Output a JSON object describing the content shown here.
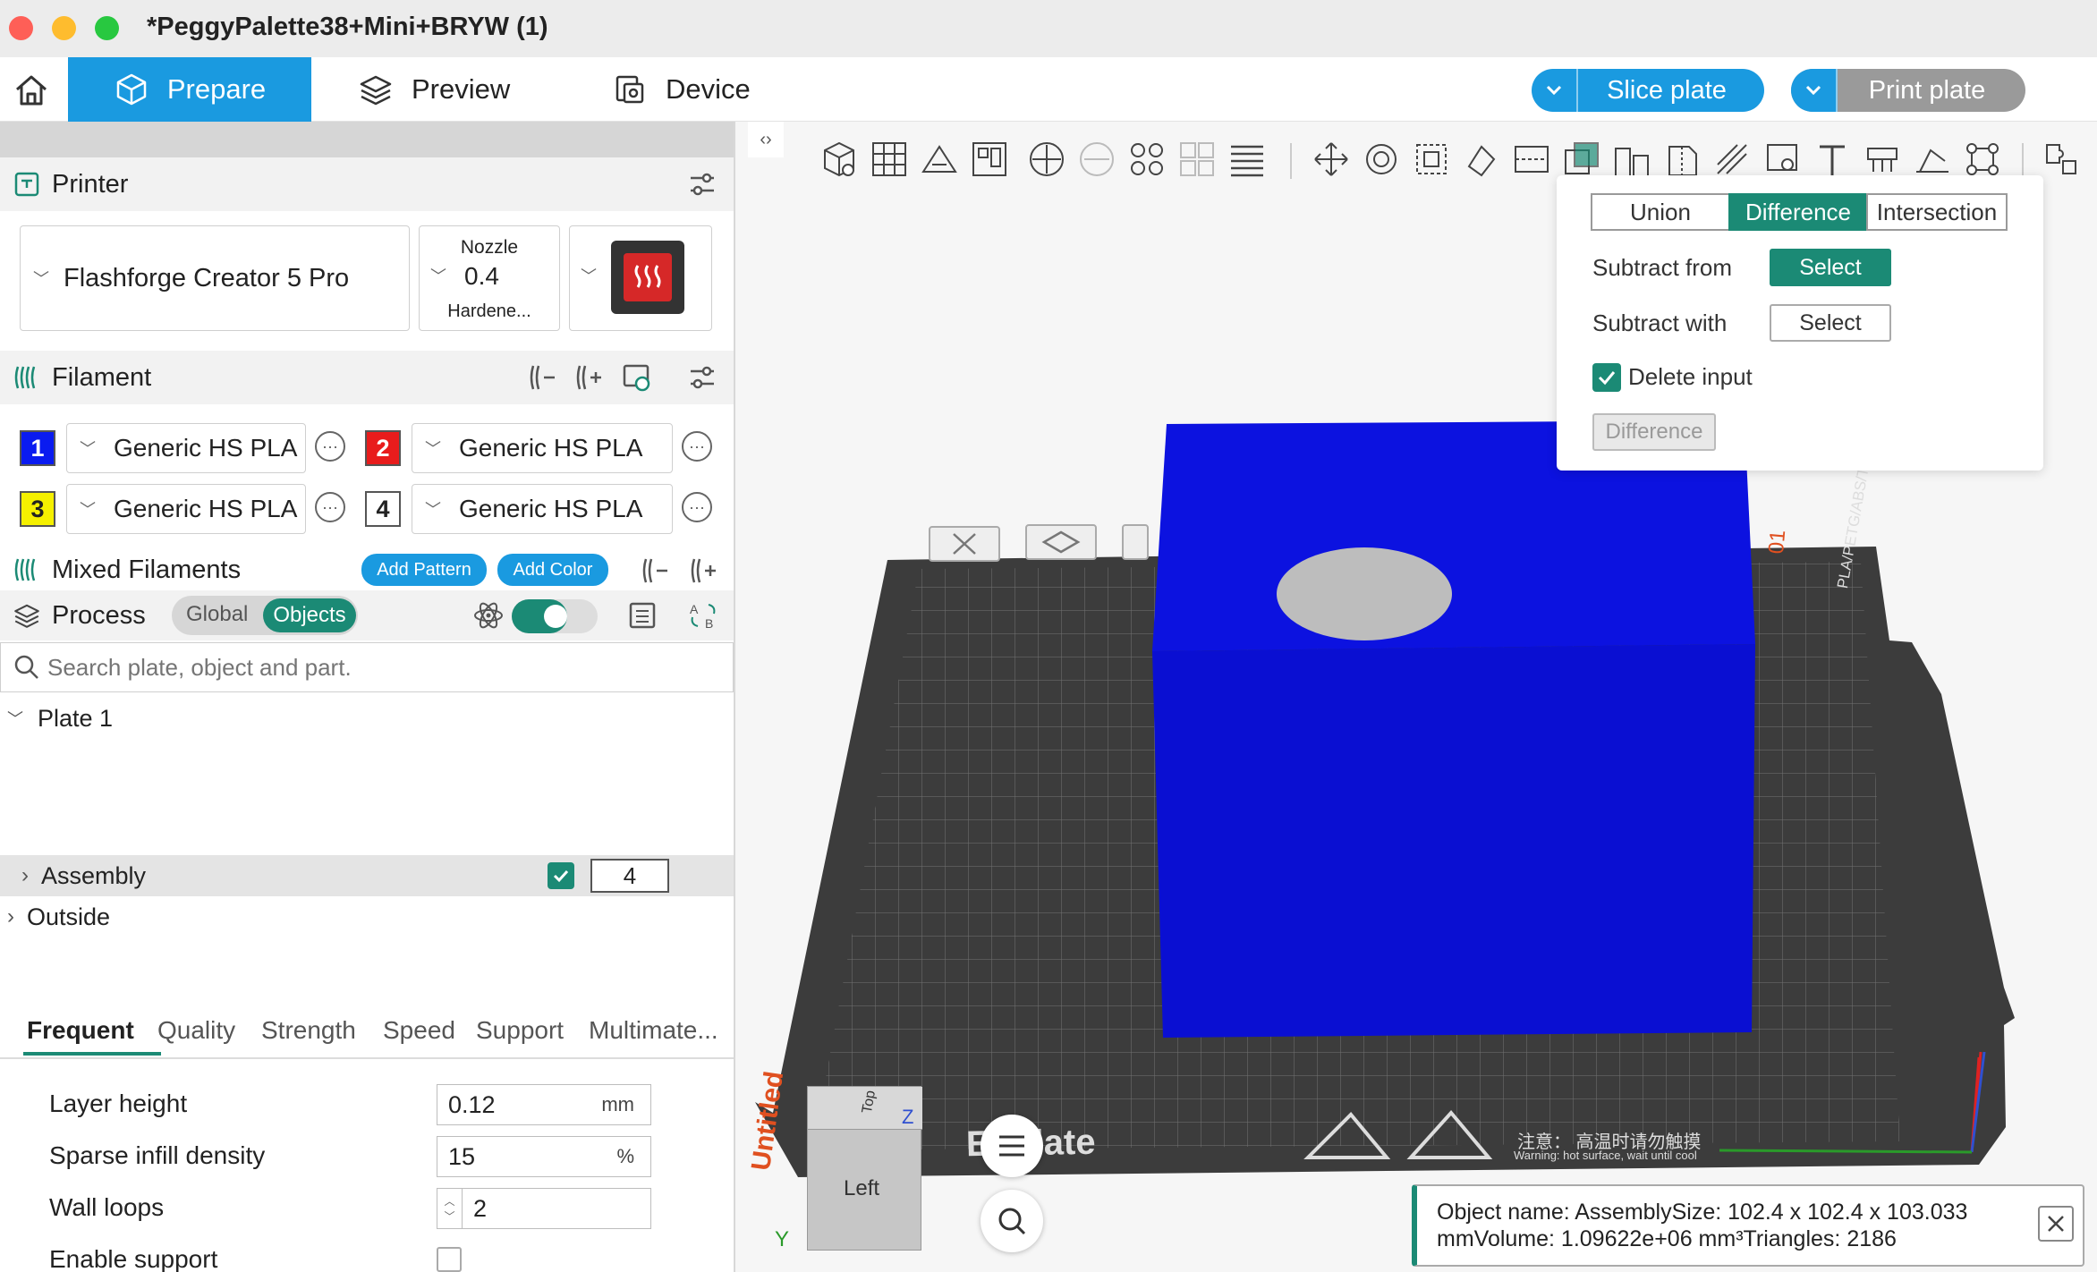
{
  "window": {
    "title": "*PeggyPalette38+Mini+BRYW (1)"
  },
  "nav": {
    "tabs": [
      {
        "label": "Prepare"
      },
      {
        "label": "Preview"
      },
      {
        "label": "Device"
      }
    ],
    "slice_label": "Slice plate",
    "print_label": "Print plate"
  },
  "printer": {
    "section_label": "Printer",
    "name": "Flashforge Creator 5 Pro",
    "nozzle_label": "Nozzle",
    "nozzle_value": "0.4",
    "nozzle_type": "Hardene..."
  },
  "filament": {
    "section_label": "Filament",
    "slots": [
      {
        "num": "1",
        "color": "#0a1bf0",
        "name": "Generic HS PLA"
      },
      {
        "num": "2",
        "color": "#e81c1c",
        "name": "Generic HS PLA"
      },
      {
        "num": "3",
        "color": "#f5f000",
        "name": "Generic HS PLA"
      },
      {
        "num": "4",
        "color": "#ffffff",
        "name": "Generic HS PLA"
      }
    ]
  },
  "mixed": {
    "section_label": "Mixed Filaments",
    "add_pattern": "Add Pattern",
    "add_color": "Add Color"
  },
  "process": {
    "section_label": "Process",
    "global_label": "Global",
    "objects_label": "Objects"
  },
  "search": {
    "placeholder": "Search plate, object and part."
  },
  "tree": {
    "plate": "Plate 1",
    "assembly": "Assembly",
    "assembly_count": "4",
    "outside": "Outside"
  },
  "settings_tabs": [
    "Frequent",
    "Quality",
    "Strength",
    "Speed",
    "Support",
    "Multimate..."
  ],
  "params": {
    "layer_height": {
      "label": "Layer height",
      "value": "0.12",
      "unit": "mm"
    },
    "infill": {
      "label": "Sparse infill density",
      "value": "15",
      "unit": "%"
    },
    "walls": {
      "label": "Wall loops",
      "value": "2"
    },
    "support": {
      "label": "Enable support",
      "checked": false
    }
  },
  "boolean": {
    "ops": [
      "Union",
      "Difference",
      "Intersection"
    ],
    "active": "Difference",
    "subtract_from_label": "Subtract from",
    "subtract_with_label": "Subtract with",
    "select_label": "Select",
    "delete_input_label": "Delete input",
    "delete_input_checked": true,
    "apply_label": "Difference"
  },
  "scene": {
    "plate_text": "EI Plate",
    "plate_side_text": "PLA/PETG/ABS/TPU",
    "plate_number": "01",
    "untitled": "Untitled",
    "warning_cn": "注意：  高温时请勿触摸",
    "warning_en": "Warning: hot surface, wait until cool",
    "view_cube_face": "Left",
    "view_cube_top": "Top",
    "axis_y": "Y",
    "axis_z": "Z"
  },
  "info": {
    "line1": "Object name: AssemblySize: 102.4 x 102.4 x 103.033",
    "line2": "mmVolume: 1.09622e+06 mm³Triangles: 2186"
  },
  "colors": {
    "accent": "#1a9ae0",
    "teal": "#1b8a75",
    "object_blue": "#0a0fd2",
    "plate": "#3a3a3a"
  }
}
